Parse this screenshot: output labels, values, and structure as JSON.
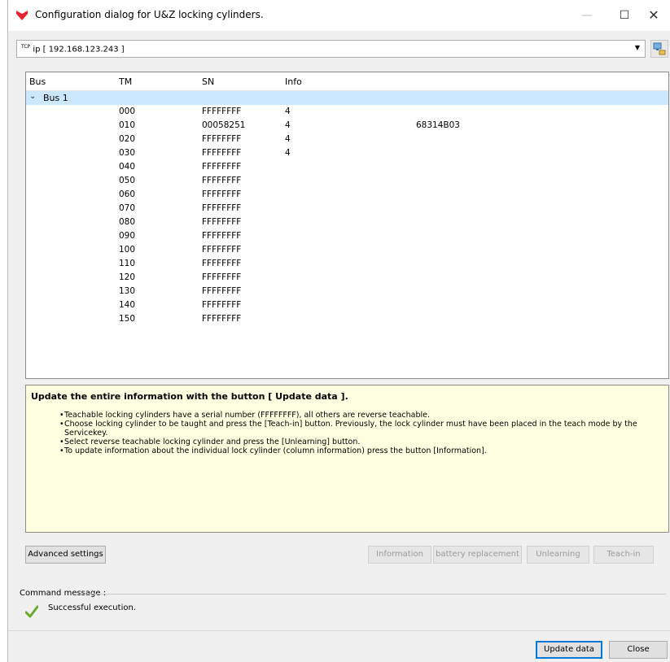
{
  "window": {
    "title": "Configuration dialog for U&Z locking cylinders.",
    "minimize_glyph": "—",
    "maximize_glyph": "☐",
    "close_glyph": "✕",
    "brand_color": "#e8232f"
  },
  "connection": {
    "prefix": "TCP",
    "value": "ip [ 192.168.123.243 ]",
    "dropdown_glyph": "▼",
    "browse_icon": "network-search-icon"
  },
  "tree": {
    "columns": [
      "Bus",
      "TM",
      "SN",
      "Info"
    ],
    "bus_expand_glyph": "⌄",
    "bus_label": "Bus 1",
    "rows": [
      {
        "tm": "000",
        "sn": "FFFFFFFF",
        "info": "4",
        "extra": ""
      },
      {
        "tm": "010",
        "sn": "00058251",
        "info": "4",
        "extra": "68314B03"
      },
      {
        "tm": "020",
        "sn": "FFFFFFFF",
        "info": "4",
        "extra": ""
      },
      {
        "tm": "030",
        "sn": "FFFFFFFF",
        "info": "4",
        "extra": ""
      },
      {
        "tm": "040",
        "sn": "FFFFFFFF",
        "info": "",
        "extra": ""
      },
      {
        "tm": "050",
        "sn": "FFFFFFFF",
        "info": "",
        "extra": ""
      },
      {
        "tm": "060",
        "sn": "FFFFFFFF",
        "info": "",
        "extra": ""
      },
      {
        "tm": "070",
        "sn": "FFFFFFFF",
        "info": "",
        "extra": ""
      },
      {
        "tm": "080",
        "sn": "FFFFFFFF",
        "info": "",
        "extra": ""
      },
      {
        "tm": "090",
        "sn": "FFFFFFFF",
        "info": "",
        "extra": ""
      },
      {
        "tm": "100",
        "sn": "FFFFFFFF",
        "info": "",
        "extra": ""
      },
      {
        "tm": "110",
        "sn": "FFFFFFFF",
        "info": "",
        "extra": ""
      },
      {
        "tm": "120",
        "sn": "FFFFFFFF",
        "info": "",
        "extra": ""
      },
      {
        "tm": "130",
        "sn": "FFFFFFFF",
        "info": "",
        "extra": ""
      },
      {
        "tm": "140",
        "sn": "FFFFFFFF",
        "info": "",
        "extra": ""
      },
      {
        "tm": "150",
        "sn": "FFFFFFFF",
        "info": "",
        "extra": ""
      }
    ]
  },
  "help": {
    "title": "Update the entire information with the button [ Update data ].",
    "items": [
      "Teachable locking cylinders have a serial number (FFFFFFFF), all others are reverse teachable.",
      "Choose locking cylinder to be taught and press the [Teach-in] button. Previously, the lock cylinder must have been placed in the teach mode by the Servicekey.",
      "Select reverse teachable locking cylinder and press the [Unlearning] button.",
      "To update information about the individual lock cylinder (column information) press the button [Information]."
    ],
    "background": "#ffffe1"
  },
  "buttons": {
    "advanced": "Advanced settings",
    "information": "Information",
    "battery": "battery replacement",
    "unlearning": "Unlearning",
    "teach_in": "Teach-in",
    "update": "Update data",
    "close": "Close"
  },
  "command": {
    "label": "Command message :",
    "message": "Successful execution.",
    "status_icon": "check-icon",
    "status_color": "#6aaa2a"
  }
}
